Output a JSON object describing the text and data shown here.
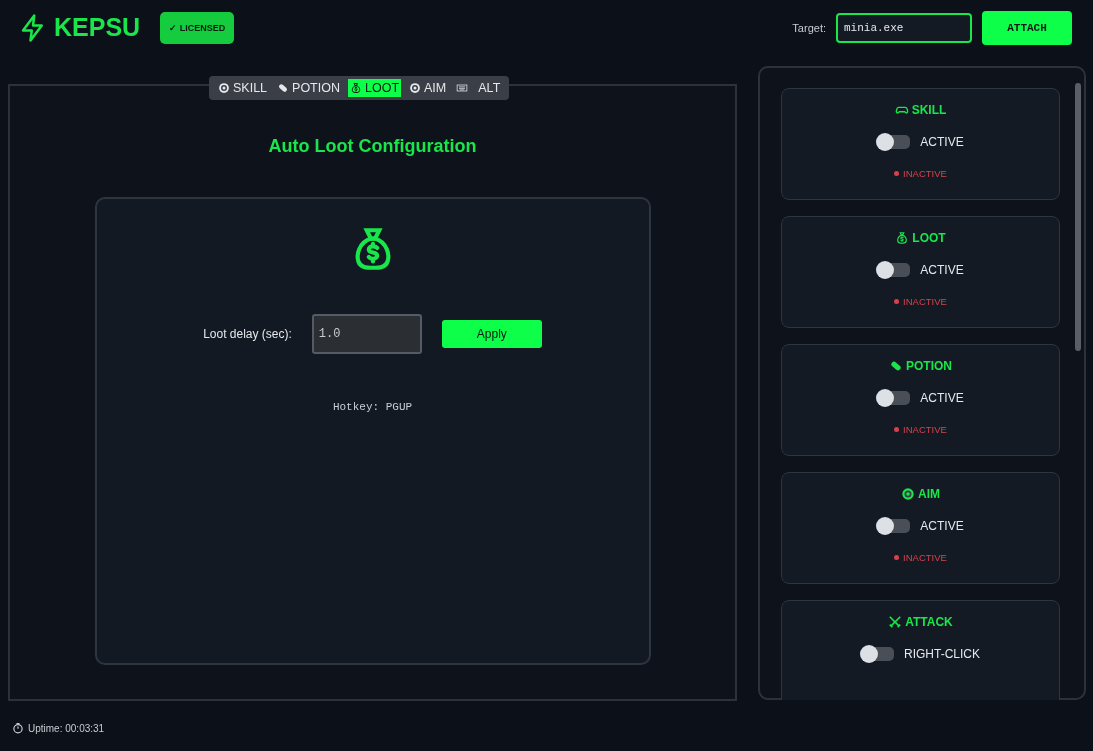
{
  "header": {
    "logo": "KEPSU",
    "license_badge": "✓ LICENSED",
    "target_label": "Target:",
    "target_value": "minia.exe",
    "attach_button": "ATTACH"
  },
  "tabs": [
    {
      "kind": "target",
      "label": "SKILL",
      "selected": false
    },
    {
      "kind": "pill",
      "label": "POTION",
      "selected": false
    },
    {
      "kind": "bag",
      "label": "LOOT",
      "selected": true
    },
    {
      "kind": "target",
      "label": "AIM",
      "selected": false
    },
    {
      "kind": "keyboard",
      "selected": false
    },
    {
      "kind": "text",
      "label": "ALT",
      "selected": false
    }
  ],
  "config": {
    "title": "Auto Loot Configuration",
    "delay_label": "Loot delay (sec):",
    "delay_value": "1.0",
    "apply_button": "Apply",
    "hotkey": "Hotkey: PGUP"
  },
  "modules": [
    {
      "kind": "gamepad",
      "name": "SKILL",
      "toggle_label": "ACTIVE",
      "on": false,
      "status": "INACTIVE"
    },
    {
      "kind": "bag",
      "name": "LOOT",
      "toggle_label": "ACTIVE",
      "on": false,
      "status": "INACTIVE"
    },
    {
      "kind": "pill",
      "name": "POTION",
      "toggle_label": "ACTIVE",
      "on": false,
      "status": "INACTIVE"
    },
    {
      "kind": "target",
      "name": "AIM",
      "toggle_label": "ACTIVE",
      "on": false,
      "status": "INACTIVE"
    },
    {
      "kind": "swords",
      "name": "ATTACK",
      "toggle_label": "RIGHT-CLICK",
      "on": false
    }
  ],
  "status_bar": {
    "uptime": "Uptime: 00:03:31"
  }
}
